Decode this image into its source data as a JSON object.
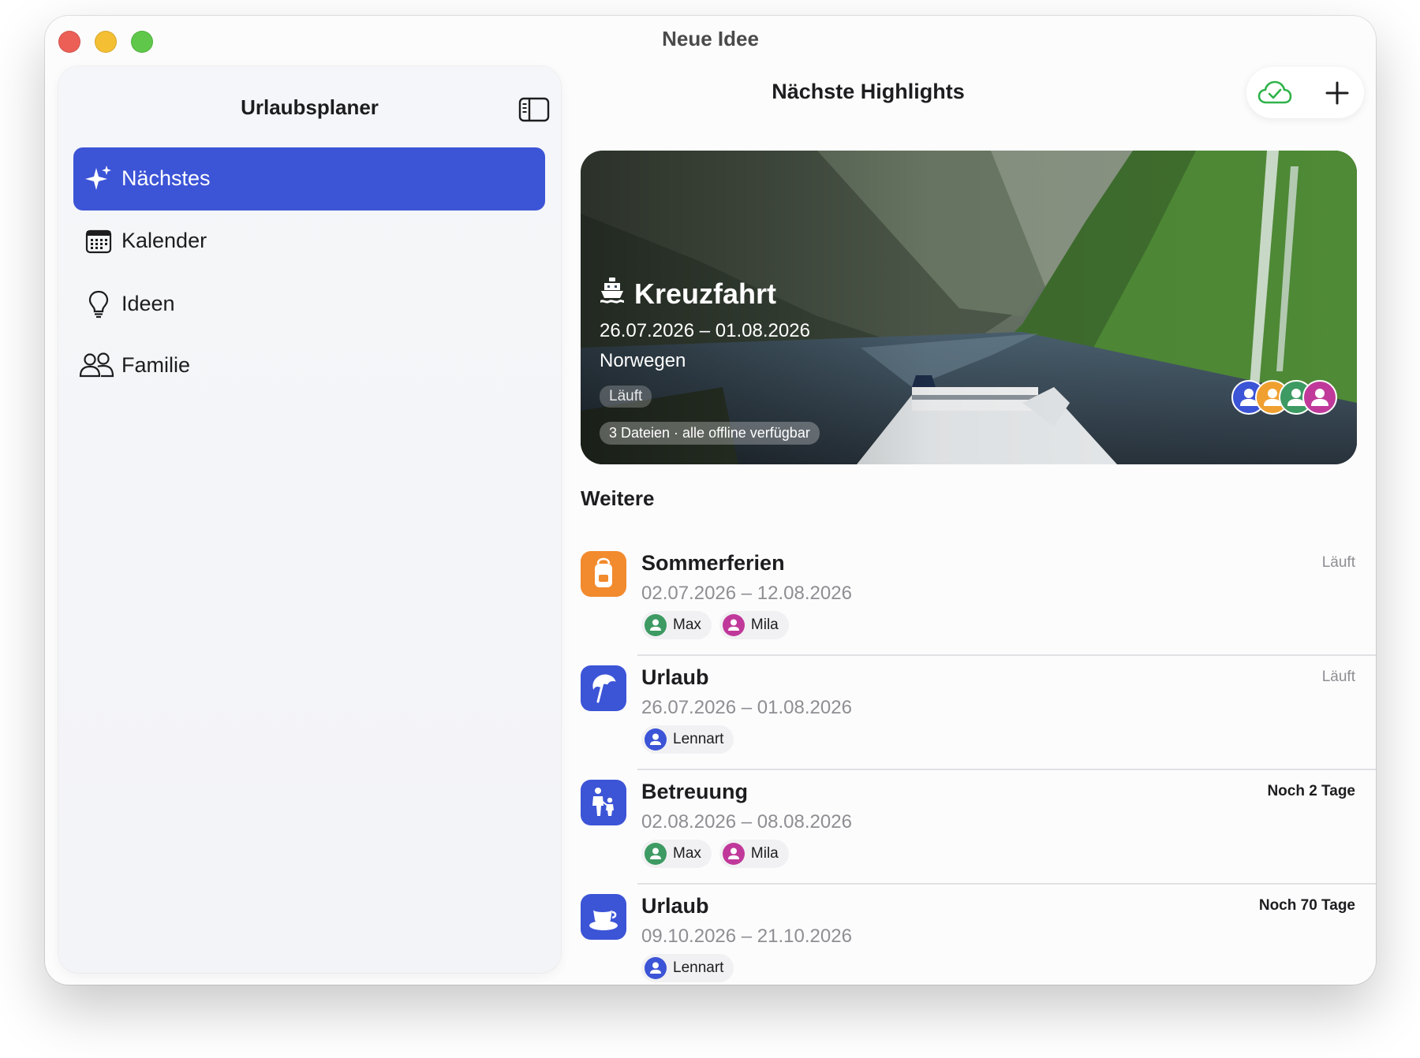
{
  "window": {
    "title": "Neue Idee"
  },
  "sidebar": {
    "title": "Urlaubsplaner",
    "items": [
      {
        "label": "Nächstes",
        "icon": "sparkles-icon",
        "active": true
      },
      {
        "label": "Kalender",
        "icon": "calendar-icon",
        "active": false
      },
      {
        "label": "Ideen",
        "icon": "lightbulb-icon",
        "active": false
      },
      {
        "label": "Familie",
        "icon": "people-icon",
        "active": false
      }
    ]
  },
  "main": {
    "title": "Nächste Highlights",
    "toolbar": {
      "sync_icon": "cloud-check-icon",
      "add_icon": "plus-icon"
    },
    "highlight": {
      "title": "Kreuzfahrt",
      "icon": "ship-icon",
      "dates": "26.07.2026 – 01.08.2026",
      "place": "Norwegen",
      "status": "Läuft",
      "files": "3 Dateien · alle offline verfügbar",
      "avatar_colors": [
        "#3c54d6",
        "#f0a030",
        "#3d9a62",
        "#c0399a"
      ]
    },
    "section_label": "Weitere",
    "rows": [
      {
        "title": "Sommerferien",
        "dates": "02.07.2026 – 12.08.2026",
        "status": "Läuft",
        "icon": "backpack-icon",
        "icon_color": "#f28a2e",
        "people": [
          {
            "name": "Max",
            "color": "#3d9a62"
          },
          {
            "name": "Mila",
            "color": "#c0399a"
          }
        ]
      },
      {
        "title": "Urlaub",
        "dates": "26.07.2026 – 01.08.2026",
        "status": "Läuft",
        "icon": "beach-umbrella-icon",
        "icon_color": "#3c54d6",
        "people": [
          {
            "name": "Lennart",
            "color": "#3c54d6"
          }
        ]
      },
      {
        "title": "Betreuung",
        "dates": "02.08.2026 – 08.08.2026",
        "status": "Noch 2 Tage",
        "icon": "parent-child-icon",
        "icon_color": "#3c54d6",
        "people": [
          {
            "name": "Max",
            "color": "#3d9a62"
          },
          {
            "name": "Mila",
            "color": "#c0399a"
          }
        ]
      },
      {
        "title": "Urlaub",
        "dates": "09.10.2026 – 21.10.2026",
        "status": "Noch 70 Tage",
        "icon": "cup-icon",
        "icon_color": "#3c54d6",
        "people": [
          {
            "name": "Lennart",
            "color": "#3c54d6"
          }
        ]
      }
    ]
  }
}
